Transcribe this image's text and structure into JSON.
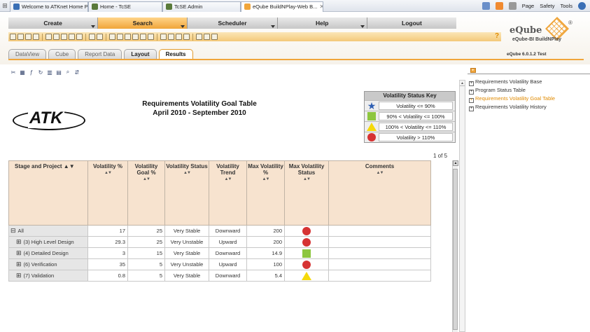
{
  "browser": {
    "tabs": [
      {
        "label": "Welcome to ATKnet Home Page"
      },
      {
        "label": "Home - TcSE"
      },
      {
        "label": "TcSE Admin"
      },
      {
        "label": "eQube BuildNPlay-Web B..."
      }
    ],
    "tools": {
      "page": "Page",
      "safety": "Safety",
      "tools": "Tools"
    }
  },
  "menu": {
    "items": [
      {
        "label": "Create"
      },
      {
        "label": "Search"
      },
      {
        "label": "Scheduler"
      },
      {
        "label": "Help"
      },
      {
        "label": "Logout"
      }
    ]
  },
  "logo": {
    "brand": "eQube",
    "reg": "®",
    "tagline": "eQube-BI BuildNPlay",
    "version": "eQube 6.0.1.2 Test"
  },
  "help_glyph": "?",
  "tabs": [
    {
      "label": "DataView"
    },
    {
      "label": "Cube"
    },
    {
      "label": "Report Data"
    },
    {
      "label": "Layout"
    },
    {
      "label": "Results"
    }
  ],
  "report": {
    "title": "Requirements Volatility Goal Table",
    "subtitle": "April 2010 - September 2010",
    "logo_text": "ATK",
    "pager": "1 of 5"
  },
  "status_key": {
    "title": "Volatility Status Key",
    "rows": [
      {
        "symbol": "star-icon",
        "text": "Volatility <= 90%",
        "color": "#2f5fb3"
      },
      {
        "symbol": "square-icon",
        "text": "90% < Volatility <= 100%",
        "color": "#8dc63f"
      },
      {
        "symbol": "triangle-icon",
        "text": "100% < Volatility <= 110%",
        "color": "#f5d90a"
      },
      {
        "symbol": "circle-icon",
        "text": "Volatility > 110%",
        "color": "#d63333"
      }
    ]
  },
  "table": {
    "columns": [
      {
        "label": "Stage and Project"
      },
      {
        "label": "Volatility %"
      },
      {
        "label": "Volatility Goal %"
      },
      {
        "label": "Volatility Status"
      },
      {
        "label": "Volatility Trend"
      },
      {
        "label": "Max Volatility %"
      },
      {
        "label": "Max Volatility Status"
      },
      {
        "label": "Comments"
      }
    ],
    "rows": [
      {
        "name": "All",
        "exp": "⊟",
        "vol": "17",
        "goal": "25",
        "status": "Very Stable",
        "trend": "Downward",
        "max": "200",
        "icon": "circle"
      },
      {
        "name": "(3) High Level Design",
        "exp": "⊞",
        "vol": "29.3",
        "goal": "25",
        "status": "Very Unstable",
        "trend": "Upward",
        "max": "200",
        "icon": "circle"
      },
      {
        "name": "(4) Detailed Design",
        "exp": "⊞",
        "vol": "3",
        "goal": "15",
        "status": "Very Stable",
        "trend": "Downward",
        "max": "14.9",
        "icon": "square"
      },
      {
        "name": "(6) Verification",
        "exp": "⊞",
        "vol": "35",
        "goal": "5",
        "status": "Very Unstable",
        "trend": "Upward",
        "max": "100",
        "icon": "circle"
      },
      {
        "name": "(7) Validation",
        "exp": "⊞",
        "vol": "0.8",
        "goal": "5",
        "status": "Very Stable",
        "trend": "Downward",
        "max": "5.4",
        "icon": "triangle"
      }
    ]
  },
  "side_panel": {
    "items": [
      {
        "label": "Requirements Volatility Base"
      },
      {
        "label": "Program Status Table"
      },
      {
        "label": "Requirements Volatility Goal Table"
      },
      {
        "label": "Requirements Volatility History"
      }
    ]
  },
  "colors": {
    "accent": "#f0a53a",
    "header_bg": "#f7e3cf",
    "active_link": "#e08a00"
  }
}
